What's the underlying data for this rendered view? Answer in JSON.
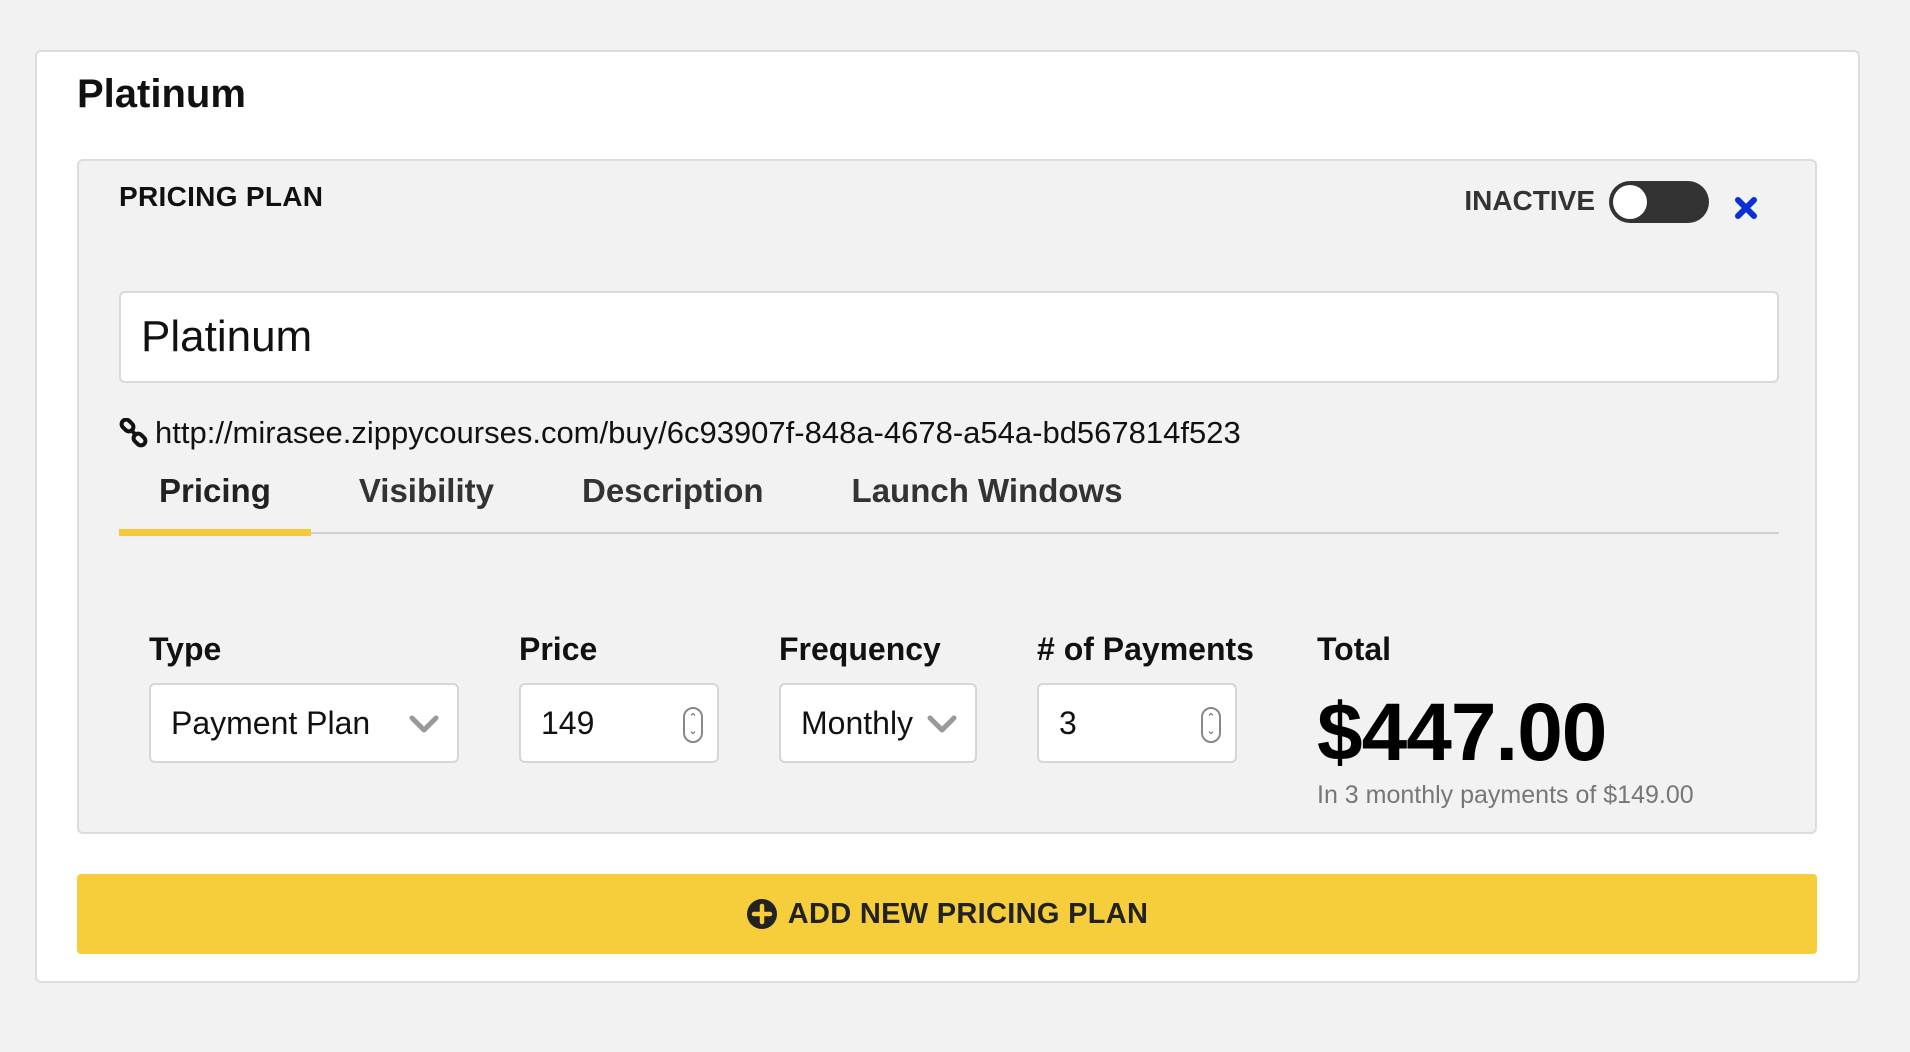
{
  "section": {
    "title": "Platinum"
  },
  "plan": {
    "heading": "PRICING PLAN",
    "status_label": "INACTIVE",
    "active": false,
    "name_value": "Platinum",
    "link_url": "http://mirasee.zippycourses.com/buy/6c93907f-848a-4678-a54a-bd567814f523",
    "tabs": [
      {
        "label": "Pricing",
        "active": true
      },
      {
        "label": "Visibility",
        "active": false
      },
      {
        "label": "Description",
        "active": false
      },
      {
        "label": "Launch Windows",
        "active": false
      }
    ],
    "fields": {
      "type": {
        "label": "Type",
        "value": "Payment Plan"
      },
      "price": {
        "label": "Price",
        "value": "149"
      },
      "frequency": {
        "label": "Frequency",
        "value": "Monthly"
      },
      "payments": {
        "label": "# of Payments",
        "value": "3"
      },
      "total": {
        "label": "Total",
        "value": "$447.00",
        "note": "In 3 monthly payments of $149.00"
      }
    }
  },
  "actions": {
    "add_plan_label": "ADD NEW PRICING PLAN"
  },
  "colors": {
    "accent": "#f6cd3b",
    "toggle_off": "#333333",
    "remove_icon": "#0a2fd6",
    "muted_text": "#777777"
  }
}
